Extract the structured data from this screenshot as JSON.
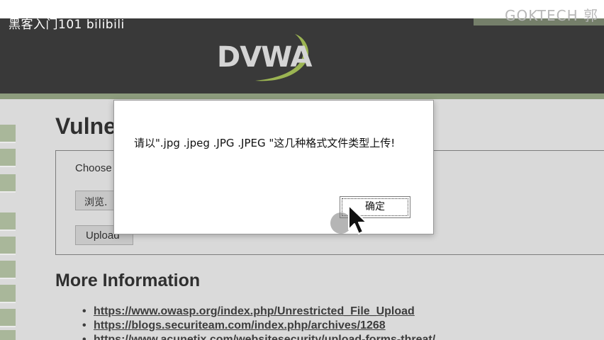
{
  "watermark": {
    "left": "黑客入门101 bilibili",
    "right": "GOKTECH 郭"
  },
  "header": {
    "logo_text": "DVWA"
  },
  "main": {
    "title": "Vulne",
    "choose_label": "Choose",
    "browse_button": "浏览.",
    "upload_button": "Upload",
    "more_info_heading": "More Information",
    "links": [
      "https://www.owasp.org/index.php/Unrestricted_File_Upload",
      "https://blogs.securiteam.com/index.php/archives/1268",
      "https://www.acunetix.com/websitesecurity/upload-forms-threat/"
    ]
  },
  "dialog": {
    "message": "请以\".jpg .jpeg .JPG .JPEG \"这几种格式文件类型上传!",
    "ok_button": "确定"
  },
  "icons": {
    "cursor": "mouse-pointer-icon",
    "logo": "dvwa-logo-swoosh"
  },
  "colors": {
    "header_bg": "#3e3e3e",
    "accent_green": "#9aaa88",
    "nav_green": "#b8c7a8",
    "page_bg": "#ededed"
  }
}
